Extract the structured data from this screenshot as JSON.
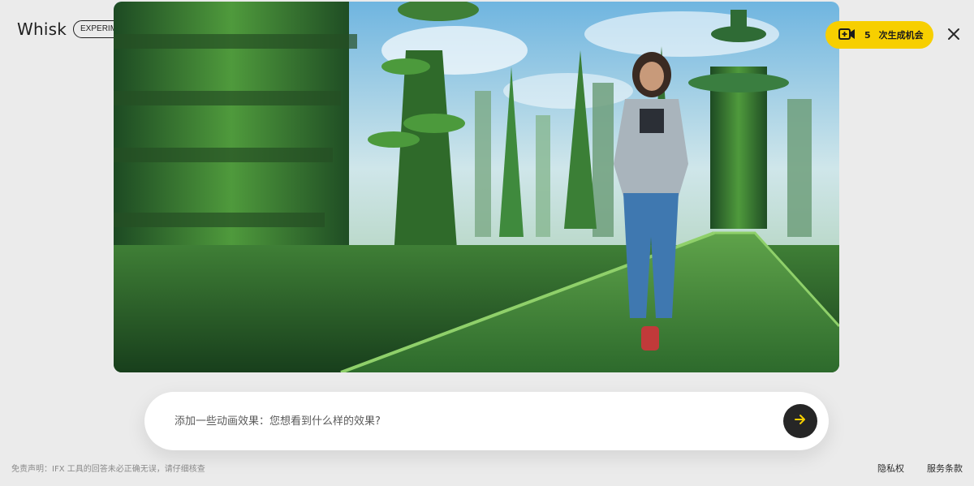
{
  "header": {
    "brand": "Whisk",
    "badge": "EXPERIMENT",
    "credits_count": "5",
    "credits_label": "次生成机会",
    "credits_icon": "video-plus-icon",
    "close_icon": "close-icon"
  },
  "prompt": {
    "placeholder": "添加一些动画效果：您想看到什么样的效果?",
    "value": "",
    "send_icon": "arrow-right-icon"
  },
  "footer": {
    "disclaimer": "免责声明：IFX 工具的回答未必正确无误，请仔细核查",
    "privacy": "隐私权",
    "terms": "服务条款"
  },
  "colors": {
    "accent": "#f7cf00",
    "send_button": "#262626",
    "background": "#ebebeb"
  }
}
